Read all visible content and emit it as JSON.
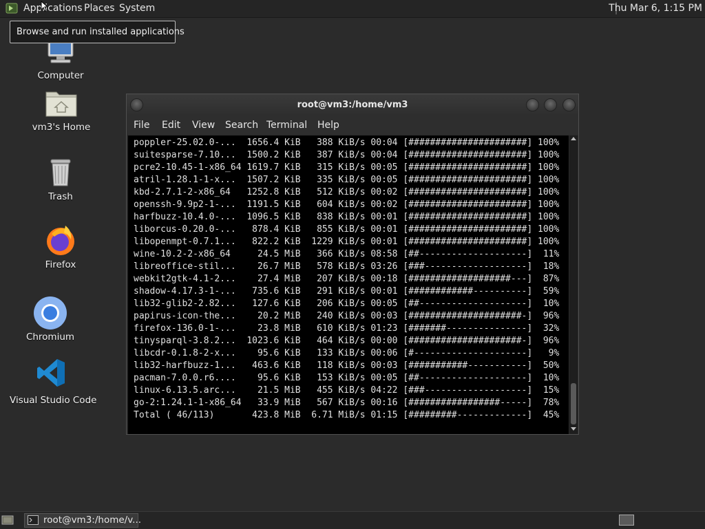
{
  "top_panel": {
    "menus": [
      "Applications",
      "Places",
      "System"
    ],
    "clock": "Thu Mar  6,  1:15 PM"
  },
  "tooltip": "Browse and run installed applications",
  "desktop_icons": [
    {
      "label": "Computer",
      "icon": "computer-icon"
    },
    {
      "label": "vm3's Home",
      "icon": "home-folder-icon"
    },
    {
      "label": "Trash",
      "icon": "trash-icon"
    },
    {
      "label": "Firefox",
      "icon": "firefox-icon"
    },
    {
      "label": "Chromium",
      "icon": "chromium-icon"
    },
    {
      "label": "Visual Studio Code",
      "icon": "vscode-icon"
    }
  ],
  "terminal": {
    "title": "root@vm3:/home/vm3",
    "menus": [
      "File",
      "Edit",
      "View",
      "Search",
      "Terminal",
      "Help"
    ],
    "lines": [
      "poppler-25.02.0-...  1656.4 KiB   388 KiB/s 00:04 [######################] 100%",
      "suitesparse-7.10...  1500.2 KiB   387 KiB/s 00:04 [######################] 100%",
      "pcre2-10.45-1-x86_64 1619.7 KiB   315 KiB/s 00:05 [######################] 100%",
      "atril-1.28.1-1-x...  1507.2 KiB   335 KiB/s 00:05 [######################] 100%",
      "kbd-2.7.1-2-x86_64   1252.8 KiB   512 KiB/s 00:02 [######################] 100%",
      "openssh-9.9p2-1-...  1191.5 KiB   604 KiB/s 00:02 [######################] 100%",
      "harfbuzz-10.4.0-...  1096.5 KiB   838 KiB/s 00:01 [######################] 100%",
      "liborcus-0.20.0-...   878.4 KiB   855 KiB/s 00:01 [######################] 100%",
      "libopenmpt-0.7.1...   822.2 KiB  1229 KiB/s 00:01 [######################] 100%",
      "wine-10.2-2-x86_64     24.5 MiB   366 KiB/s 08:58 [##--------------------]  11%",
      "libreoffice-stil...    26.7 MiB   578 KiB/s 03:26 [###-------------------]  18%",
      "webkit2gtk-4.1-2...    27.4 MiB   207 KiB/s 00:18 [###################---]  87%",
      "shadow-4.17.3-1-...   735.6 KiB   291 KiB/s 00:01 [############----------]  59%",
      "lib32-glib2-2.82...   127.6 KiB   206 KiB/s 00:05 [##--------------------]  10%",
      "papirus-icon-the...    20.2 MiB   240 KiB/s 00:03 [#####################-]  96%",
      "firefox-136.0-1-...    23.8 MiB   610 KiB/s 01:23 [#######---------------]  32%",
      "tinysparql-3.8.2...  1023.6 KiB   464 KiB/s 00:00 [#####################-]  96%",
      "libcdr-0.1.8-2-x...    95.6 KiB   133 KiB/s 00:06 [#---------------------]   9%",
      "lib32-harfbuzz-1...   463.6 KiB   118 KiB/s 00:03 [###########-----------]  50%",
      "pacman-7.0.0.r6....    95.6 KiB   153 KiB/s 00:05 [##--------------------]  10%",
      "linux-6.13.5.arc...    21.5 MiB   455 KiB/s 04:22 [###-------------------]  15%",
      "go-2:1.24.1-1-x86_64   33.9 MiB   567 KiB/s 00:16 [#################-----]  78%",
      "Total ( 46/113)       423.8 MiB  6.71 MiB/s 01:15 [#########-------------]  45%"
    ]
  },
  "taskbar": {
    "task_label": "root@vm3:/home/v..."
  }
}
